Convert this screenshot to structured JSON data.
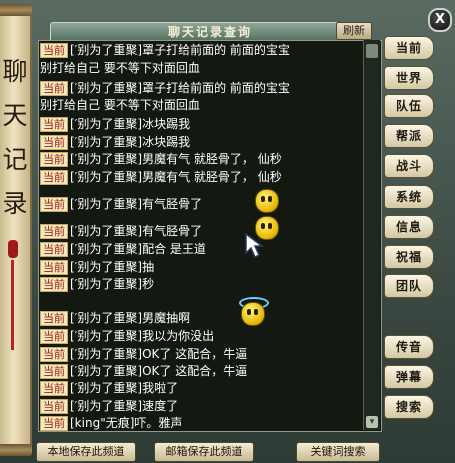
{
  "window": {
    "title": "聊天记录查询",
    "refresh_label": "刷新",
    "close_label": "X"
  },
  "side_scroll": {
    "text": "聊天记录"
  },
  "log": {
    "tag": "当前",
    "messages": [
      {
        "text": "[′别为了重聚]罩子打给前面的 前面的宝宝",
        "cont": "别打给自己 要不等下对面回血"
      },
      {
        "text": "[′别为了重聚]罩子打给前面的 前面的宝宝",
        "cont": "别打给自己 要不等下对面回血"
      },
      {
        "text": "[′别为了重聚]冰块踢我"
      },
      {
        "text": "[′别为了重聚]冰块踢我"
      },
      {
        "text": "[′别为了重聚]男魔有气 就胫骨了， 仙秒"
      },
      {
        "text": "[′别为了重聚]男魔有气 就胫骨了， 仙秒"
      },
      {
        "text": "[′别为了重聚]有气胫骨了"
      },
      {
        "text": "[′别为了重聚]有气胫骨了"
      },
      {
        "text": "[′别为了重聚]配合 是王道"
      },
      {
        "text": "[′别为了重聚]抽"
      },
      {
        "text": "[′别为了重聚]秒"
      },
      {
        "text": "[′别为了重聚]男魔抽啊"
      },
      {
        "text": "[′别为了重聚]我以为你没出"
      },
      {
        "text": "[′别为了重聚]OK了 这配合，牛逼"
      },
      {
        "text": "[′别为了重聚]OK了 这配合，牛逼"
      },
      {
        "text": "[′别为了重聚]我啦了"
      },
      {
        "text": "[′别为了重聚]速度了"
      },
      {
        "text": "[king\"无痕]吓。雅声"
      }
    ]
  },
  "channels": [
    "当前",
    "世界",
    "队伍",
    "帮派",
    "战斗",
    "系统",
    "信息",
    "祝福",
    "团队",
    "传音",
    "弹幕",
    "搜索"
  ],
  "bottom": {
    "save_local": "本地保存此频道",
    "save_mail": "邮箱保存此频道",
    "keyword_search": "关键词搜索"
  },
  "colors": {
    "tag_text": "#a31e0c",
    "tag_bg": "#f1e9c2",
    "log_bg": "#131810"
  }
}
